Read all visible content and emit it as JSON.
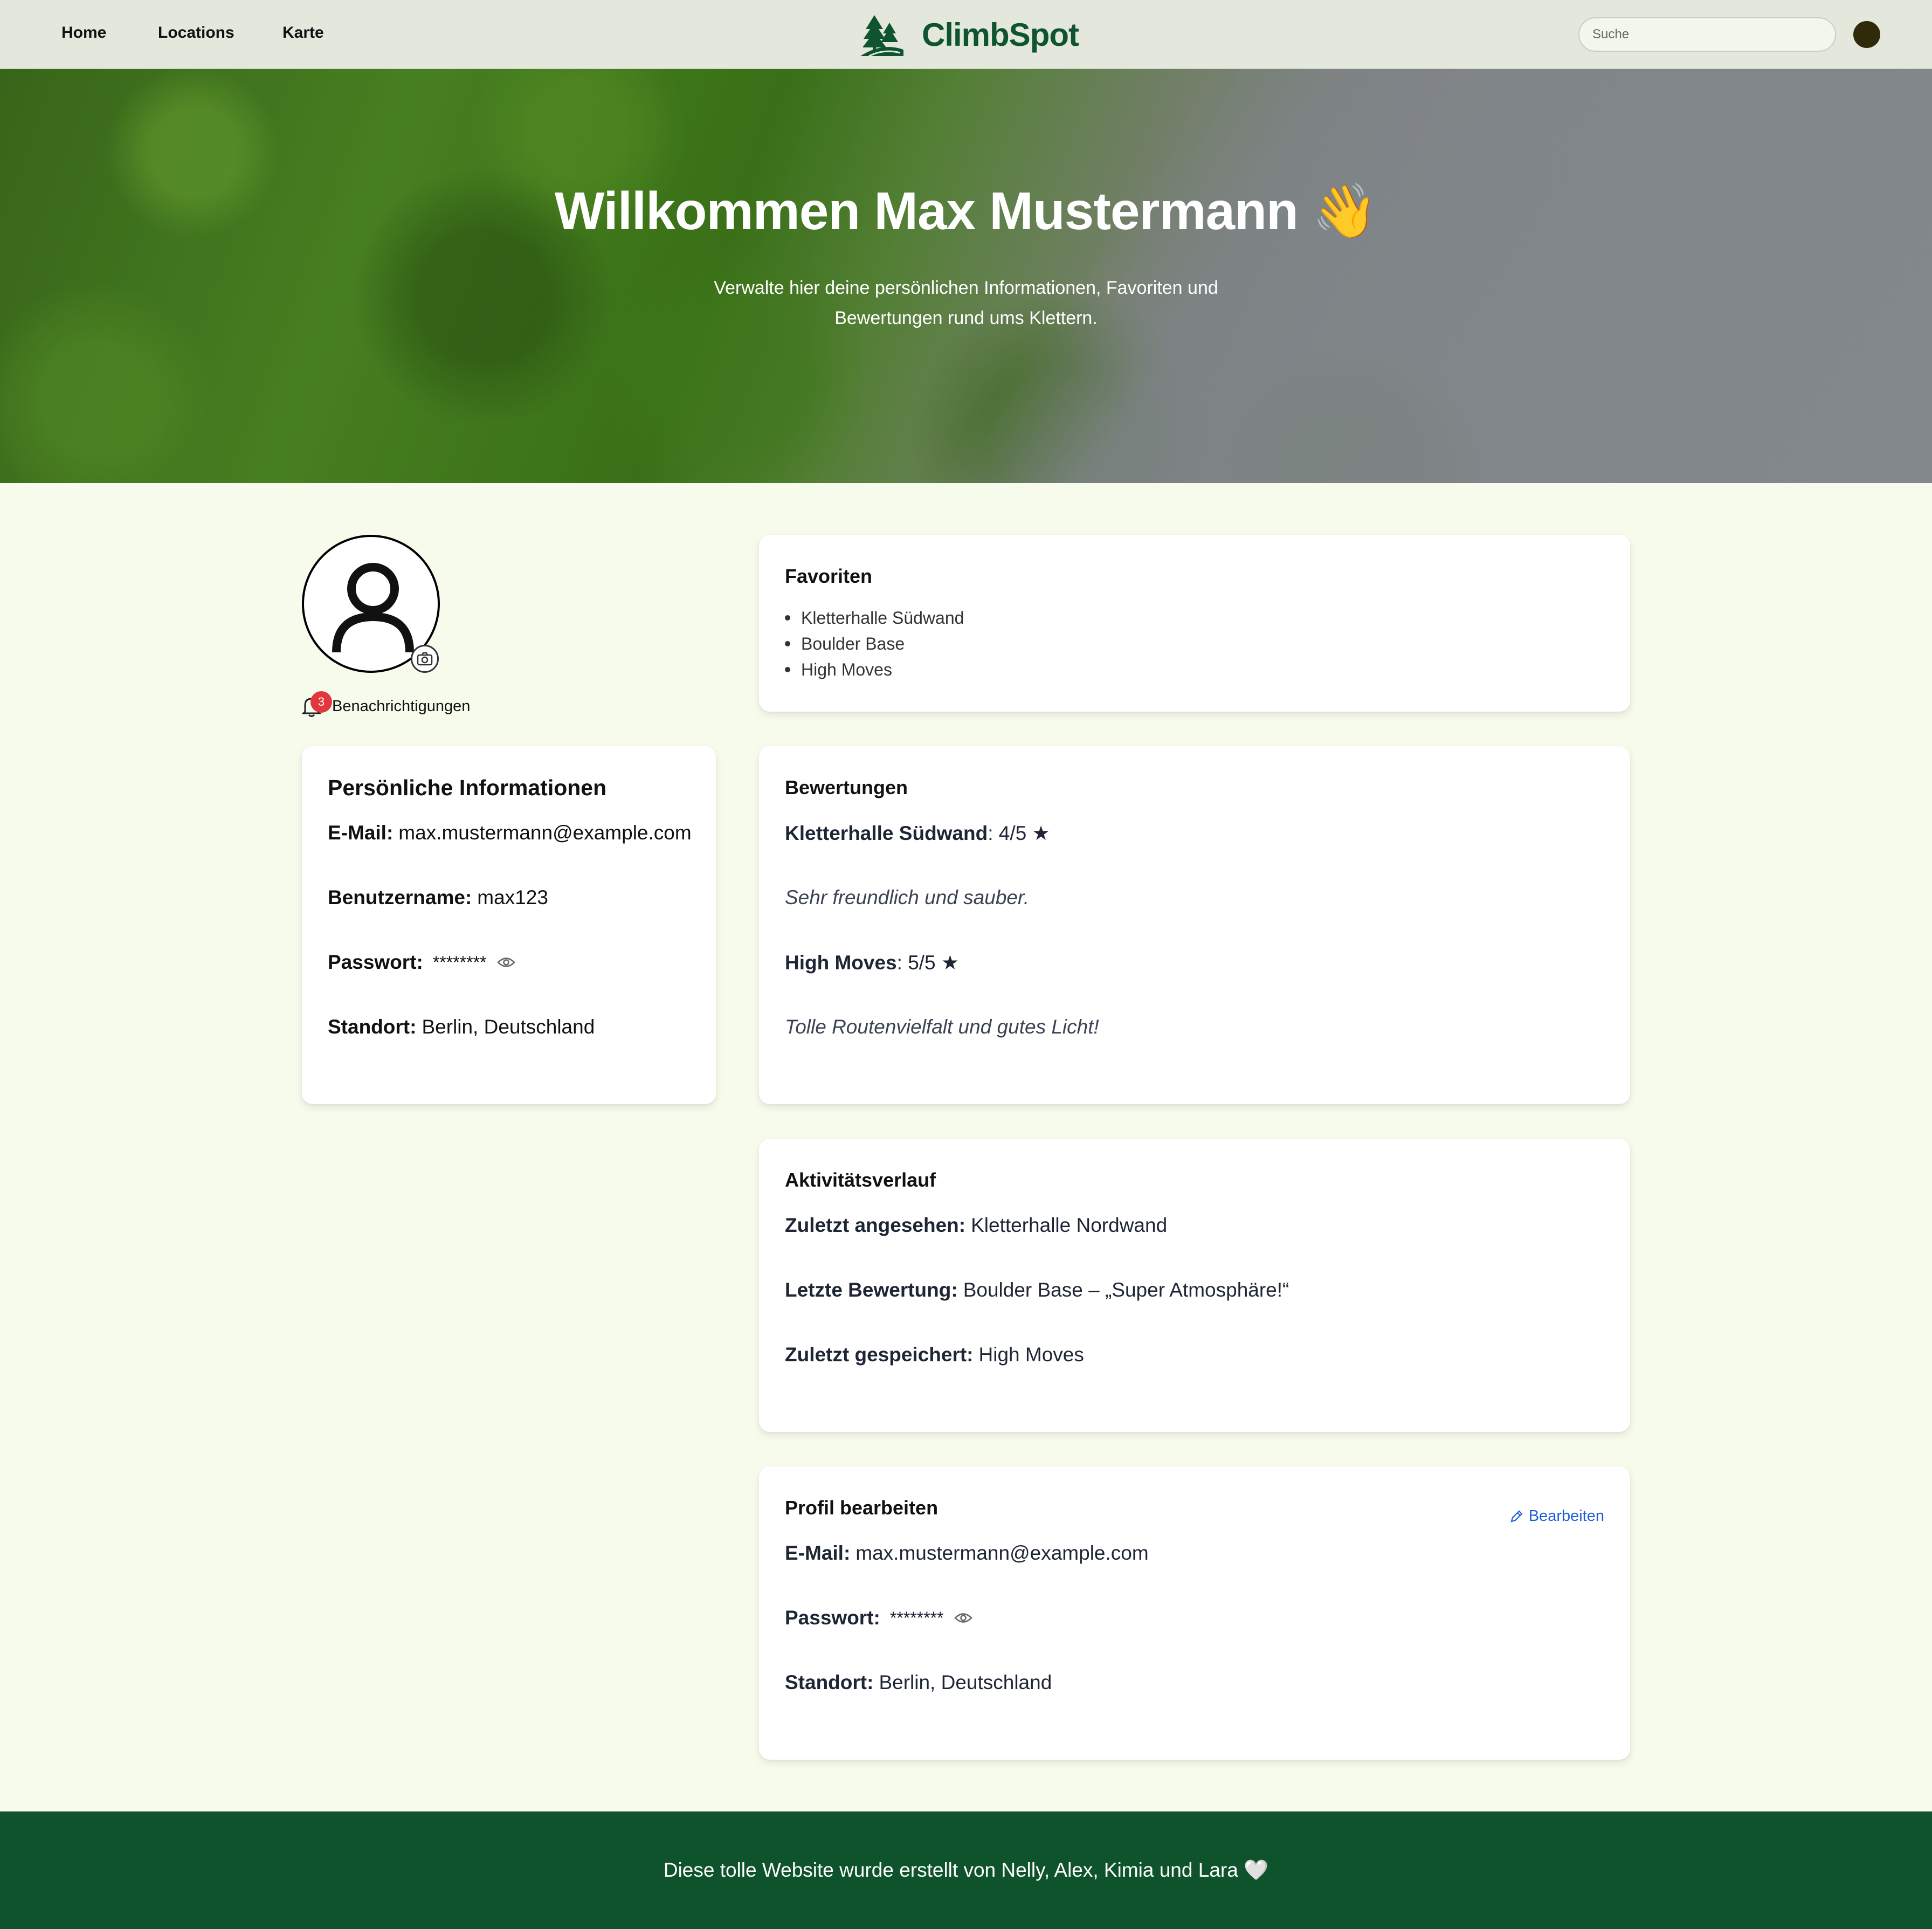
{
  "nav": {
    "links": [
      "Home",
      "Locations",
      "Karte"
    ],
    "brand": "ClimbSpot",
    "search_placeholder": "Suche"
  },
  "hero": {
    "title": "Willkommen Max Mustermann 👋",
    "subtitle": "Verwalte hier deine persönlichen Informationen, Favoriten und Bewertungen rund ums Klettern."
  },
  "profile": {
    "notifications_count": "3",
    "notifications_label": "Benachrichtigungen"
  },
  "personal": {
    "title": "Persönliche Informationen",
    "email_label": "E-Mail:",
    "email": "max.mustermann@example.com",
    "username_label": "Benutzername:",
    "username": "max123",
    "password_label": "Passwort:",
    "password": "********",
    "location_label": "Standort:",
    "location": "Berlin, Deutschland"
  },
  "favorites": {
    "title": "Favoriten",
    "items": [
      "Kletterhalle Südwand",
      "Boulder Base",
      "High Moves"
    ]
  },
  "reviews": {
    "title": "Bewertungen",
    "items": [
      {
        "place": "Kletterhalle Südwand",
        "rating": ": 4/5 ★",
        "comment": "Sehr freundlich und sauber."
      },
      {
        "place": "High Moves",
        "rating": ": 5/5 ★",
        "comment": "Tolle Routenvielfalt und gutes Licht!"
      }
    ]
  },
  "activity": {
    "title": "Aktivitätsverlauf",
    "viewed_label": "Zuletzt angesehen:",
    "viewed": "Kletterhalle Nordwand",
    "review_label": "Letzte Bewertung:",
    "review": "Boulder Base – „Super Atmosphäre!“",
    "saved_label": "Zuletzt gespeichert:",
    "saved": "High Moves"
  },
  "edit": {
    "title": "Profil bearbeiten",
    "edit_link": "Bearbeiten",
    "email_label": "E-Mail:",
    "email": "max.mustermann@example.com",
    "password_label": "Passwort:",
    "password": "********",
    "location_label": "Standort:",
    "location": "Berlin, Deutschland"
  },
  "footer": {
    "text": "Diese tolle Website wurde erstellt von Nelly, Alex, Kimia und Lara 🤍"
  },
  "colors": {
    "brand_green": "#0f5430",
    "footer_green": "#0f532c",
    "page_bg": "#f7fbec",
    "nav_bg": "#e4e8dc",
    "badge_red": "#e2373f",
    "link_blue": "#1e5fd8"
  }
}
